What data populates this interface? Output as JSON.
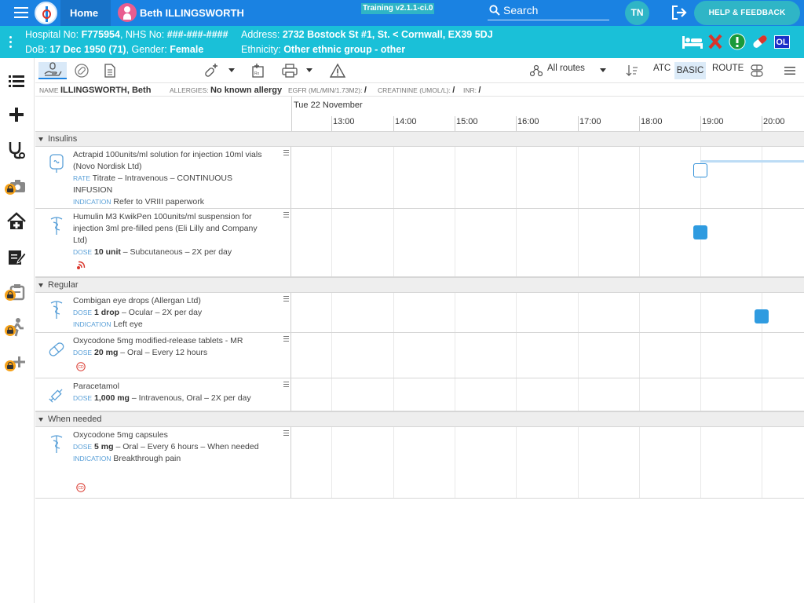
{
  "topbar": {
    "home_label": "Home",
    "patient_name": "Beth ILLINGSWORTH",
    "training_badge": "Training v2.1.1-ci.0",
    "search_placeholder": "Search",
    "user_initials": "TN",
    "help_label": "HELP & FEEDBACK"
  },
  "banner": {
    "hospital_label": "Hospital No:",
    "hospital_no": "F775954",
    "nhs_label": "NHS No:",
    "nhs_no": "###-###-####",
    "address_label": "Address:",
    "address": "2732 Bostock St #1, St. < Cornwall, EX39 5DJ",
    "dob_label": "DoB:",
    "dob": "17 Dec 1950 (71)",
    "gender_label": "Gender:",
    "gender": "Female",
    "ethnicity_label": "Ethnicity:",
    "ethnicity": "Other ethnic group - other",
    "ol_badge": "OL"
  },
  "toolbar": {
    "routes_label": "All routes",
    "atc_label": "ATC",
    "basic_label": "BASIC",
    "route_label": "ROUTE"
  },
  "info": {
    "name_label": "NAME",
    "name_value": "ILLINGSWORTH, Beth",
    "allergies_label": "ALLERGIES:",
    "allergies_value": "No known allergy",
    "egfr_label": "EGFR (ML/MIN/1.73M2):",
    "egfr_value": "/",
    "creatinine_label": "CREATININE (UMOL/L):",
    "creatinine_value": "/",
    "inr_label": "INR:",
    "inr_value": "/"
  },
  "timeline": {
    "date": "Tue 22 November",
    "hours": [
      "13:00",
      "14:00",
      "15:00",
      "16:00",
      "17:00",
      "18:00",
      "19:00",
      "20:00"
    ]
  },
  "sections": {
    "insulins": "Insulins",
    "regular": "Regular",
    "when_needed": "When needed"
  },
  "medications": {
    "actrapid": {
      "name": "Actrapid 100units/ml solution for injection 10ml vials (Novo Nordisk Ltd)",
      "rate_label": "RATE",
      "rate": "Titrate – Intravenous – CONTINUOUS INFUSION",
      "indication_label": "INDICATION",
      "indication": "Refer to VRIII paperwork"
    },
    "humulin": {
      "name": "Humulin M3 KwikPen 100units/ml suspension for injection 3ml pre-filled pens (Eli Lilly and Company Ltd)",
      "dose_label": "DOSE",
      "dose": "10 unit",
      "dose_detail": "– Subcutaneous – 2X per day"
    },
    "combigan": {
      "name": "Combigan eye drops (Allergan Ltd)",
      "dose_label": "DOSE",
      "dose": "1 drop",
      "dose_detail": "– Ocular – 2X per day",
      "indication_label": "INDICATION",
      "indication": "Left eye"
    },
    "oxycodone_mr": {
      "name": "Oxycodone 5mg modified-release tablets - MR",
      "dose_label": "DOSE",
      "dose": "20 mg",
      "dose_detail": "– Oral – Every 12 hours",
      "badge": "CD"
    },
    "paracetamol": {
      "name": "Paracetamol",
      "dose_label": "DOSE",
      "dose": "1,000 mg",
      "dose_detail": "– Intravenous, Oral – 2X per day"
    },
    "oxycodone_caps": {
      "name": "Oxycodone 5mg capsules",
      "dose_label": "DOSE",
      "dose": "5 mg",
      "dose_detail": "– Oral – Every 6 hours – When needed",
      "indication_label": "INDICATION",
      "indication": "Breakthrough pain",
      "badge": "CD"
    }
  },
  "colors": {
    "topbar": "#1a82e2",
    "banner": "#1ac0d8",
    "accent": "#2f9be0",
    "lock": "#f6a21a",
    "alert_red": "#d9352b"
  }
}
